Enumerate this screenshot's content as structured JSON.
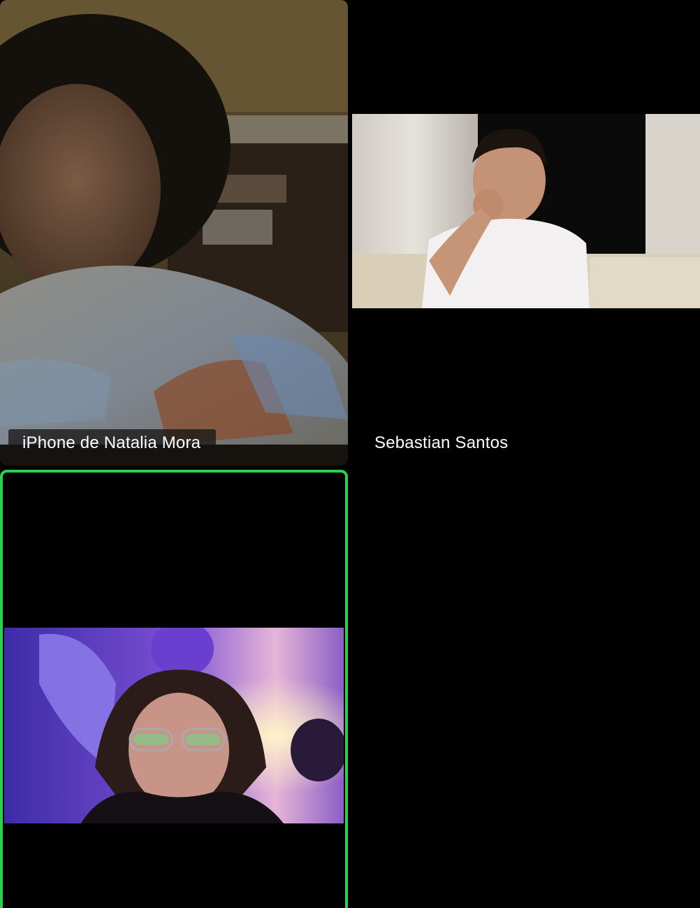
{
  "participants": [
    {
      "name": "iPhone de Natalia Mora",
      "video_on": true,
      "active_speaker": false
    },
    {
      "name": "Sebastian Santos",
      "video_on": true,
      "active_speaker": false
    },
    {
      "name": "",
      "video_on": true,
      "active_speaker": true
    },
    {
      "name": "",
      "video_on": false,
      "active_speaker": false
    }
  ],
  "colors": {
    "active_speaker_border": "#2bd04d",
    "tile_background": "#000000",
    "label_text": "#ffffff"
  }
}
